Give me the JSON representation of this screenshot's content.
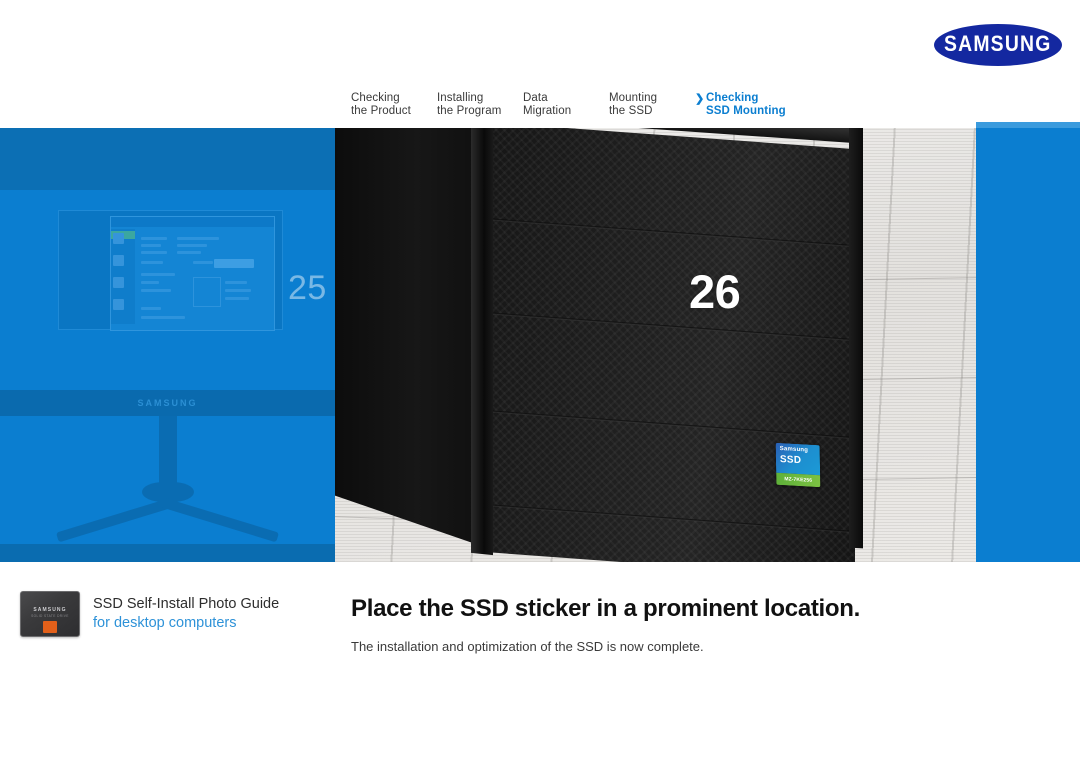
{
  "brand": {
    "logo_text": "SAMSUNG",
    "logo_color": "#1428a0"
  },
  "nav": {
    "items": [
      {
        "line1": "Checking",
        "line2": "the Product",
        "active": false
      },
      {
        "line1": "Installing",
        "line2": "the Program",
        "active": false
      },
      {
        "line1": "Data",
        "line2": "Migration",
        "active": false
      },
      {
        "line1": "Mounting",
        "line2": "the SSD",
        "active": false
      },
      {
        "line1": "Checking",
        "line2": "SSD Mounting",
        "active": true
      }
    ],
    "active_chevron": "❯",
    "active_color": "#0b7ed0",
    "inactive_color": "#3a3a3a"
  },
  "pagination": {
    "previous_page": "25",
    "current_page": "26"
  },
  "hero": {
    "accent_blue": "#0b7ed0",
    "sticker": {
      "brand": "Samsung",
      "product": "SSD",
      "badge": "MZ-7KE256"
    }
  },
  "previous_page_preview": {
    "monitor_brand": "SAMSUNG"
  },
  "footer": {
    "guide_title": "SSD Self-Install Photo Guide",
    "guide_subtitle": "for desktop computers",
    "thumbnail": {
      "logo": "SAMSUNG",
      "sub": "SOLID STATE DRIVE"
    }
  },
  "content": {
    "headline": "Place the SSD sticker in a prominent location.",
    "subline": "The installation and optimization of the SSD is now complete."
  }
}
